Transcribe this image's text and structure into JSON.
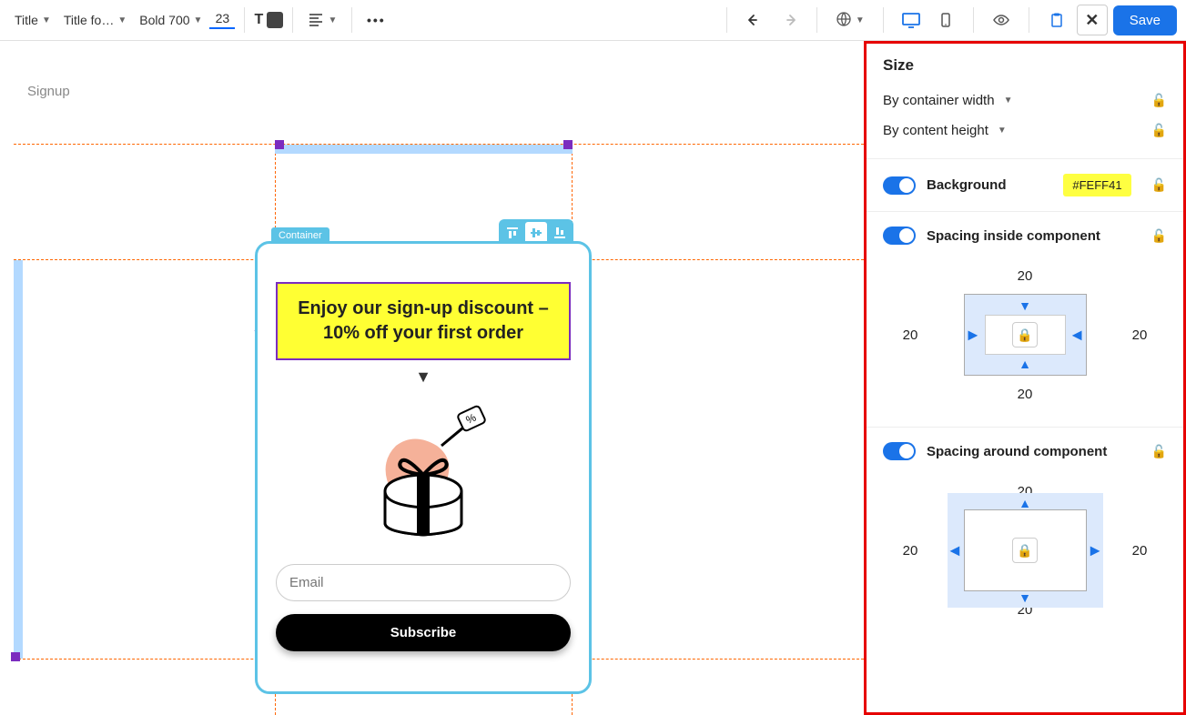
{
  "toolbar": {
    "textType": "Title",
    "fontFamily": "Title fo…",
    "fontWeight": "Bold 700",
    "fontSize": "23",
    "moreDots": "•••",
    "saveLabel": "Save"
  },
  "canvas": {
    "pageName": "Signup",
    "containerBadge": "Container",
    "signupTitle": "Enjoy our sign-up discount – 10% off your first order",
    "emailPlaceholder": "Email",
    "subscribeLabel": "Subscribe"
  },
  "sidebar": {
    "sizeHeader": "Size",
    "widthMode": "By container width",
    "heightMode": "By content height",
    "backgroundLabel": "Background",
    "backgroundColor": "#FEFF41",
    "spacingInsideLabel": "Spacing inside component",
    "spacingInside": {
      "top": "20",
      "right": "20",
      "bottom": "20",
      "left": "20"
    },
    "spacingAroundLabel": "Spacing around component",
    "spacingAround": {
      "top": "20",
      "right": "20",
      "bottom": "20",
      "left": "20"
    }
  }
}
